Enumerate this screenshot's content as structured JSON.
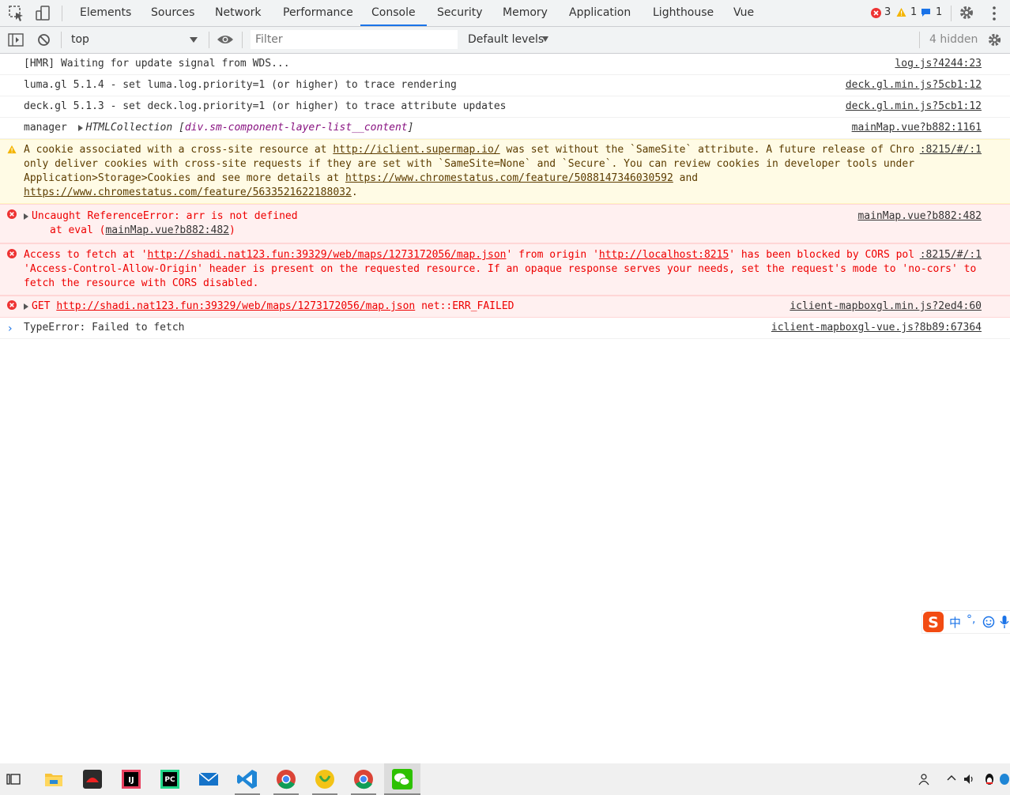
{
  "tabs": [
    "Elements",
    "Sources",
    "Network",
    "Performance",
    "Console",
    "Security",
    "Memory",
    "Application",
    "Lighthouse",
    "Vue"
  ],
  "active_tab": "Console",
  "counts": {
    "errors": "3",
    "warnings": "1",
    "infos": "1"
  },
  "toolbar": {
    "context": "top",
    "filter_placeholder": "Filter",
    "levels": "Default levels",
    "hidden": "4 hidden"
  },
  "messages": [
    {
      "text": "[HMR] Waiting for update signal from WDS...",
      "source": "log.js?4244:23"
    },
    {
      "text": "luma.gl 5.1.4 - set luma.log.priority=1 (or higher) to trace rendering",
      "source": "deck.gl.min.js?5cb1:12"
    },
    {
      "text": "deck.gl 5.1.3 - set deck.log.priority=1 (or higher) to trace attribute updates",
      "source": "deck.gl.min.js?5cb1:12"
    },
    {
      "label": "manager",
      "collection": "HTMLCollection",
      "element": "div.sm-component-layer-list__content",
      "source": "mainMap.vue?b882:1161"
    }
  ],
  "warning": {
    "t1": "A cookie associated with a cross-site resource at ",
    "link1": "http://iclient.supermap.io/",
    "t2": " was set without the `SameSite` attribute. A future release of Chrome will only deliver cookies with cross-site requests if they are set with `SameSite=None` and `Secure`. You can review cookies in developer tools under Application>Storage>Cookies and see more details at ",
    "link2": "https://www.chromestatus.com/feature/5088147346030592",
    "t3": " and ",
    "link3": "https://www.chromestatus.com/feature/5633521622188032",
    "t4": ".",
    "source": ":8215/#/:1"
  },
  "error1": {
    "text": "Uncaught ReferenceError: arr is not defined",
    "at": "at eval (",
    "at_link": "mainMap.vue?b882:482",
    "at_end": ")",
    "source": "mainMap.vue?b882:482"
  },
  "error2": {
    "t1": "Access to fetch at '",
    "link1": "http://shadi.nat123.fun:39329/web/maps/1273172056/map.json",
    "t2": "' from origin '",
    "link2": "http://localhost:8215",
    "t3": "' has been blocked by CORS policy: No 'Access-Control-Allow-Origin' header is present on the requested resource. If an opaque response serves your needs, set the request's mode to 'no-cors' to fetch the resource with CORS disabled.",
    "source": ":8215/#/:1"
  },
  "error3": {
    "method": "GET",
    "link": "http://shadi.nat123.fun:39329/web/maps/1273172056/map.json",
    "status": "net::ERR_FAILED",
    "source": "iclient-mapboxgl.min.js?2ed4:60"
  },
  "typeerror": {
    "text": "TypeError: Failed to fetch",
    "source": "iclient-mapboxgl-vue.js?8b89:67364"
  },
  "prompt": "›",
  "ime": {
    "zh": "中",
    "punct": "°,"
  },
  "colors": {
    "accent": "#1a73e8",
    "error": "#e00",
    "warning_bg": "#fffbe5",
    "error_bg": "#fff0f0"
  }
}
